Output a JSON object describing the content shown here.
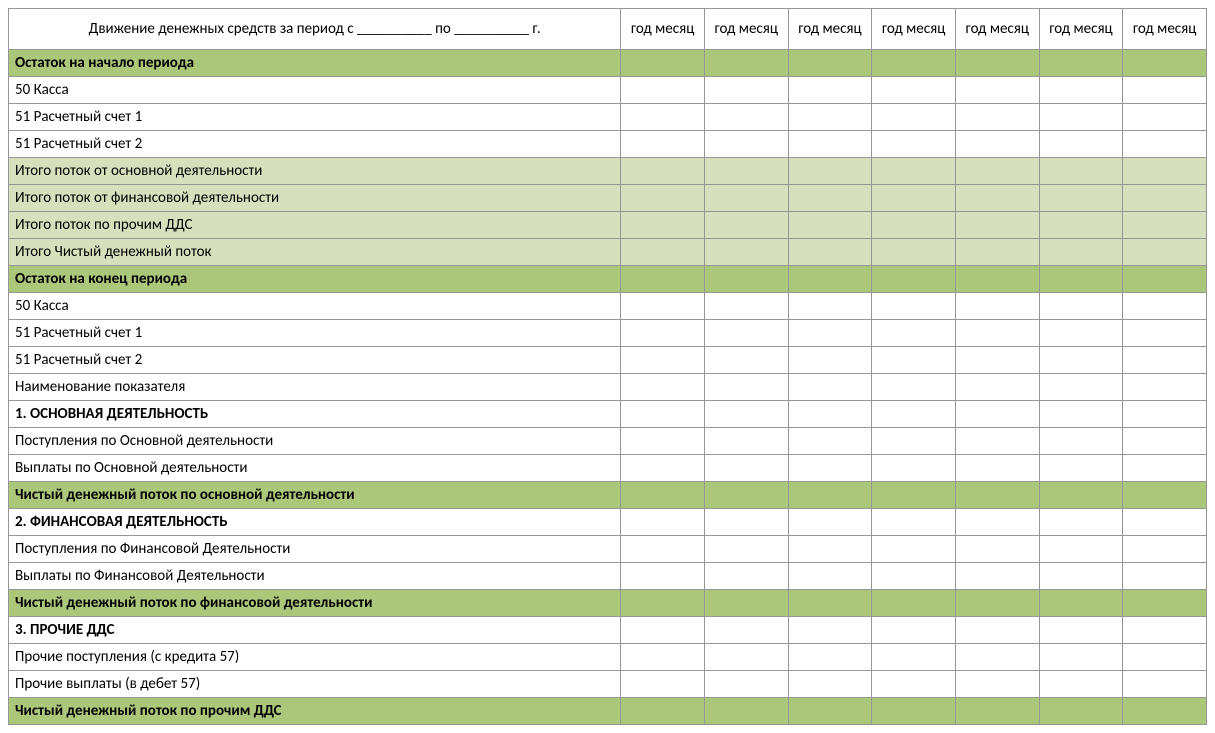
{
  "header": {
    "title": "Движение денежных средств за период с __________ по __________ г.",
    "month_cols": [
      "год месяц",
      "год месяц",
      "год месяц",
      "год месяц",
      "год месяц",
      "год месяц",
      "год месяц"
    ]
  },
  "rows": [
    {
      "label": "Остаток на начало периода",
      "style": "dark",
      "bold": true
    },
    {
      "label": "50 Касса",
      "style": "plain"
    },
    {
      "label": "51 Расчетный счет 1",
      "style": "plain"
    },
    {
      "label": "51 Расчетный счет 2",
      "style": "plain"
    },
    {
      "label": "Итого поток от основной деятельности",
      "style": "light-nobold"
    },
    {
      "label": "Итого поток от финансовой деятельности",
      "style": "light-nobold"
    },
    {
      "label": "Итого поток по прочим ДДС",
      "style": "light-nobold"
    },
    {
      "label": "Итого Чистый денежный поток",
      "style": "light-nobold"
    },
    {
      "label": "Остаток на конец периода",
      "style": "dark",
      "bold": true
    },
    {
      "label": "50 Касса",
      "style": "plain"
    },
    {
      "label": "51 Расчетный счет 1",
      "style": "plain"
    },
    {
      "label": "51 Расчетный счет 2",
      "style": "plain"
    },
    {
      "label": "Наименование показателя",
      "style": "plain"
    },
    {
      "label": "1. ОСНОВНАЯ ДЕЯТЕЛЬНОСТЬ",
      "style": "plain",
      "bold": true
    },
    {
      "label": "Поступления по Основной деятельности",
      "style": "plain"
    },
    {
      "label": "Выплаты по Основной деятельности",
      "style": "plain"
    },
    {
      "label": "Чистый денежный поток по основной деятельности",
      "style": "dark",
      "bold": true
    },
    {
      "label": "2. ФИНАНСОВАЯ ДЕЯТЕЛЬНОСТЬ",
      "style": "plain",
      "bold": true
    },
    {
      "label": "Поступления по Финансовой Деятельности",
      "style": "plain"
    },
    {
      "label": "Выплаты по Финансовой Деятельности",
      "style": "plain"
    },
    {
      "label": "Чистый денежный поток по финансовой деятельности",
      "style": "dark",
      "bold": true
    },
    {
      "label": "3. ПРОЧИЕ ДДС",
      "style": "plain",
      "bold": true
    },
    {
      "label": "Прочие поступления (с кредита 57)",
      "style": "plain"
    },
    {
      "label": "Прочие выплаты (в дебет 57)",
      "style": "plain"
    },
    {
      "label": "Чистый денежный поток по прочим ДДС",
      "style": "dark",
      "bold": true
    }
  ]
}
